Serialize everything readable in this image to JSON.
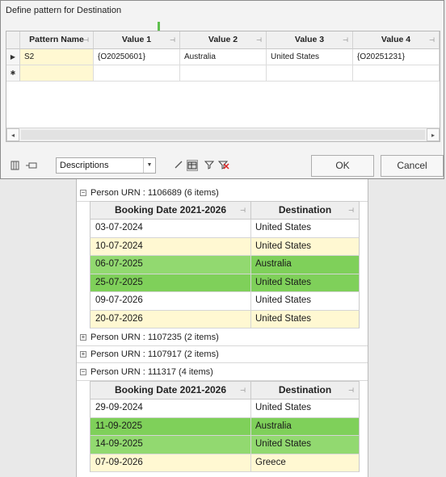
{
  "dialog": {
    "title": "Define pattern for Destination",
    "columns": [
      "Pattern Name",
      "Value 1",
      "Value 2",
      "Value 3",
      "Value 4"
    ],
    "rows": [
      {
        "pattern_name": "S2",
        "value1": "{O20250601}",
        "value2": "Australia",
        "value3": "United States",
        "value4": "{O20251231}"
      }
    ],
    "new_row_marker": "✱",
    "current_row_marker": "▶",
    "display_select": {
      "value": "Descriptions"
    },
    "ok_label": "OK",
    "cancel_label": "Cancel",
    "colors": {
      "yellow": "#fff8d2",
      "accent_green": "#5fc04e"
    }
  },
  "report": {
    "subheader": {
      "col1": "Booking Date 2021-2026",
      "col2": "Destination"
    },
    "groups": [
      {
        "label": "Person URN : 1106689 (6 items)",
        "expanded": true,
        "rows": [
          {
            "date": "03-07-2024",
            "destination": "United States",
            "highlight": "white"
          },
          {
            "date": "10-07-2024",
            "destination": "United States",
            "highlight": "yellow"
          },
          {
            "date": "06-07-2025",
            "destination": "Australia",
            "highlight": "green"
          },
          {
            "date": "25-07-2025",
            "destination": "United States",
            "highlight": "green"
          },
          {
            "date": "09-07-2026",
            "destination": "United States",
            "highlight": "white"
          },
          {
            "date": "20-07-2026",
            "destination": "United States",
            "highlight": "yellow"
          }
        ]
      },
      {
        "label": "Person URN : 1107235 (2 items)",
        "expanded": false,
        "rows": []
      },
      {
        "label": "Person URN : 1107917 (2 items)",
        "expanded": false,
        "rows": []
      },
      {
        "label": "Person URN : 111317 (4 items)",
        "expanded": true,
        "rows": [
          {
            "date": "29-09-2024",
            "destination": "United States",
            "highlight": "white"
          },
          {
            "date": "11-09-2025",
            "destination": "Australia",
            "highlight": "green"
          },
          {
            "date": "14-09-2025",
            "destination": "United States",
            "highlight": "green"
          },
          {
            "date": "07-09-2026",
            "destination": "Greece",
            "highlight": "yellow"
          }
        ]
      }
    ]
  }
}
